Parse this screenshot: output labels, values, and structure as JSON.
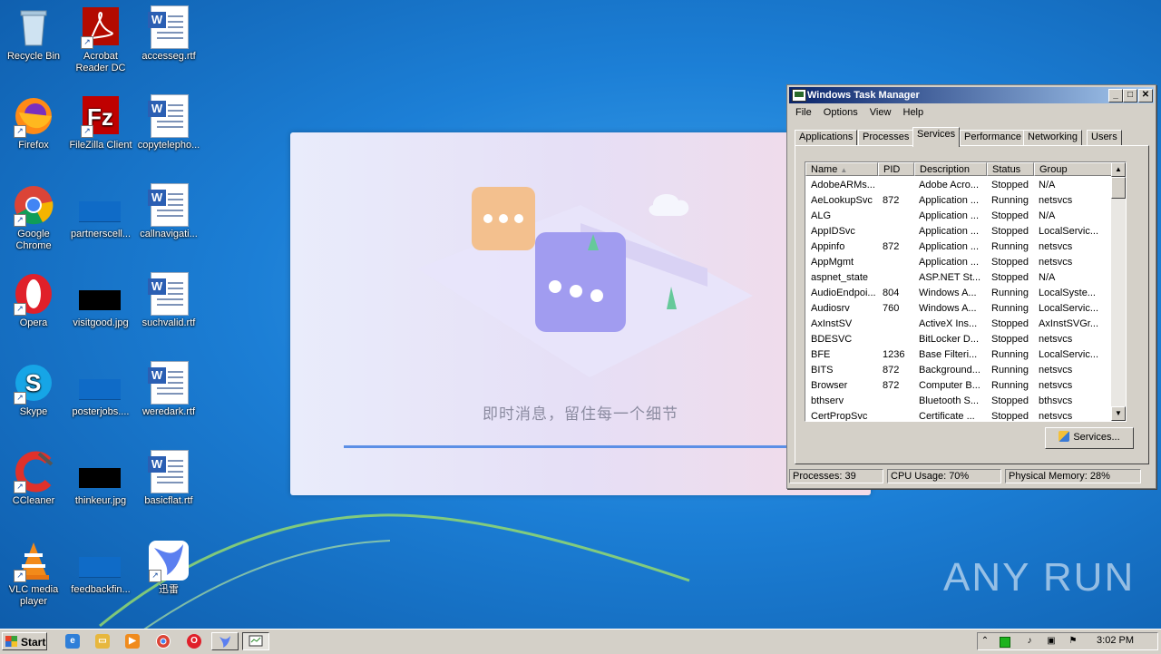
{
  "desktop": {
    "icons": [
      {
        "label": "Recycle Bin"
      },
      {
        "label": "Acrobat Reader DC"
      },
      {
        "label": "accesseg.rtf"
      },
      {
        "label": "Firefox"
      },
      {
        "label": "FileZilla Client"
      },
      {
        "label": "copytelepho..."
      },
      {
        "label": "Google Chrome"
      },
      {
        "label": "partnerscell..."
      },
      {
        "label": "callnavigati..."
      },
      {
        "label": "Opera"
      },
      {
        "label": "visitgood.jpg"
      },
      {
        "label": "suchvalid.rtf"
      },
      {
        "label": "Skype"
      },
      {
        "label": "posterjobs...."
      },
      {
        "label": "weredark.rtf"
      },
      {
        "label": "CCleaner"
      },
      {
        "label": "thinkeur.jpg"
      },
      {
        "label": "basicflat.rtf"
      },
      {
        "label": "VLC media player"
      },
      {
        "label": "feedbackfin..."
      },
      {
        "label": "迅雷"
      }
    ]
  },
  "splash": {
    "tagline": "即时消息，留住每一个细节",
    "progress": 0.77
  },
  "task_manager": {
    "title": "Windows Task Manager",
    "menu": [
      "File",
      "Options",
      "View",
      "Help"
    ],
    "tabs": [
      "Applications",
      "Processes",
      "Services",
      "Performance",
      "Networking",
      "Users"
    ],
    "active_tab": "Services",
    "columns": [
      "Name",
      "PID",
      "Description",
      "Status",
      "Group"
    ],
    "services": [
      {
        "name": "AdobeARMs...",
        "pid": "",
        "desc": "Adobe Acro...",
        "status": "Stopped",
        "group": "N/A"
      },
      {
        "name": "AeLookupSvc",
        "pid": "872",
        "desc": "Application ...",
        "status": "Running",
        "group": "netsvcs"
      },
      {
        "name": "ALG",
        "pid": "",
        "desc": "Application ...",
        "status": "Stopped",
        "group": "N/A"
      },
      {
        "name": "AppIDSvc",
        "pid": "",
        "desc": "Application ...",
        "status": "Stopped",
        "group": "LocalServic..."
      },
      {
        "name": "Appinfo",
        "pid": "872",
        "desc": "Application ...",
        "status": "Running",
        "group": "netsvcs"
      },
      {
        "name": "AppMgmt",
        "pid": "",
        "desc": "Application ...",
        "status": "Stopped",
        "group": "netsvcs"
      },
      {
        "name": "aspnet_state",
        "pid": "",
        "desc": "ASP.NET St...",
        "status": "Stopped",
        "group": "N/A"
      },
      {
        "name": "AudioEndpoi...",
        "pid": "804",
        "desc": "Windows A...",
        "status": "Running",
        "group": "LocalSyste..."
      },
      {
        "name": "Audiosrv",
        "pid": "760",
        "desc": "Windows A...",
        "status": "Running",
        "group": "LocalServic..."
      },
      {
        "name": "AxInstSV",
        "pid": "",
        "desc": "ActiveX Ins...",
        "status": "Stopped",
        "group": "AxInstSVGr..."
      },
      {
        "name": "BDESVC",
        "pid": "",
        "desc": "BitLocker D...",
        "status": "Stopped",
        "group": "netsvcs"
      },
      {
        "name": "BFE",
        "pid": "1236",
        "desc": "Base Filteri...",
        "status": "Running",
        "group": "LocalServic..."
      },
      {
        "name": "BITS",
        "pid": "872",
        "desc": "Background...",
        "status": "Running",
        "group": "netsvcs"
      },
      {
        "name": "Browser",
        "pid": "872",
        "desc": "Computer B...",
        "status": "Running",
        "group": "netsvcs"
      },
      {
        "name": "bthserv",
        "pid": "",
        "desc": "Bluetooth S...",
        "status": "Stopped",
        "group": "bthsvcs"
      },
      {
        "name": "CertPropSvc",
        "pid": "",
        "desc": "Certificate ...",
        "status": "Stopped",
        "group": "netsvcs"
      }
    ],
    "services_button": "Services...",
    "status": {
      "processes": "Processes: 39",
      "cpu": "CPU Usage: 70%",
      "memory": "Physical Memory: 28%"
    }
  },
  "taskbar": {
    "start_label": "Start",
    "clock": "3:02 PM"
  },
  "watermark": "ANY RUN"
}
